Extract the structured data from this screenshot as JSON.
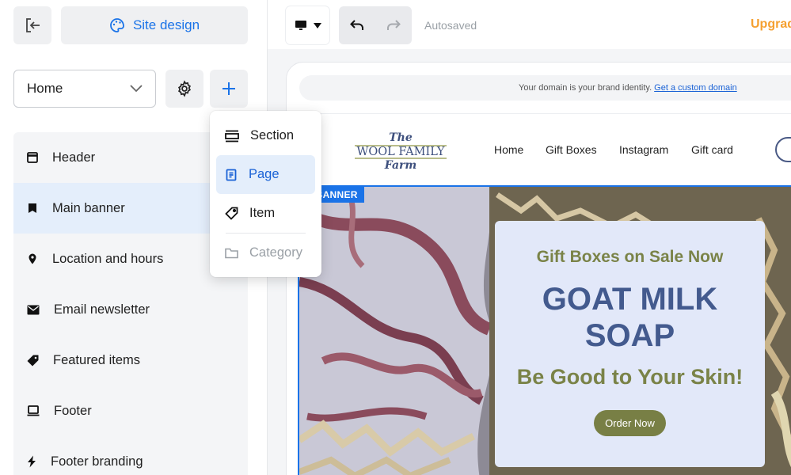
{
  "toolbar": {
    "site_design_label": "Site design",
    "autosaved": "Autosaved",
    "upgrade": "Upgrad"
  },
  "page_select": {
    "value": "Home"
  },
  "sections": [
    {
      "label": "Header",
      "icon": "header-icon"
    },
    {
      "label": "Main banner",
      "icon": "bookmark-icon",
      "active": true
    },
    {
      "label": "Location and hours",
      "icon": "location-pin-icon"
    },
    {
      "label": "Email newsletter",
      "icon": "envelope-icon"
    },
    {
      "label": "Featured items",
      "icon": "tag-icon"
    },
    {
      "label": "Footer",
      "icon": "laptop-icon"
    },
    {
      "label": "Footer branding",
      "icon": "bolt-icon"
    }
  ],
  "add_menu": {
    "items": [
      {
        "label": "Section",
        "icon": "section-icon"
      },
      {
        "label": "Page",
        "icon": "page-icon",
        "active": true
      },
      {
        "label": "Item",
        "icon": "tag-icon"
      },
      {
        "label": "Category",
        "icon": "folder-icon",
        "disabled": true
      }
    ]
  },
  "preview": {
    "domain_text": "Your domain is your brand identity.",
    "domain_link": "Get a custom domain",
    "logo": {
      "line1": "The",
      "line2": "WOOL FAMILY",
      "line3": "Farm"
    },
    "nav": [
      "Home",
      "Gift Boxes",
      "Instagram",
      "Gift card"
    ],
    "banner_tag": "N BANNER",
    "banner": {
      "pre": "Gift Boxes on Sale Now",
      "title_line1": "GOAT MILK",
      "title_line2": "SOAP",
      "subtitle": "Be Good to Your Skin!",
      "button": "Order Now"
    }
  },
  "colors": {
    "accent": "#1a73e8",
    "upgrade": "#f5a030",
    "olive": "#7a8348",
    "navy": "#435a8e"
  }
}
